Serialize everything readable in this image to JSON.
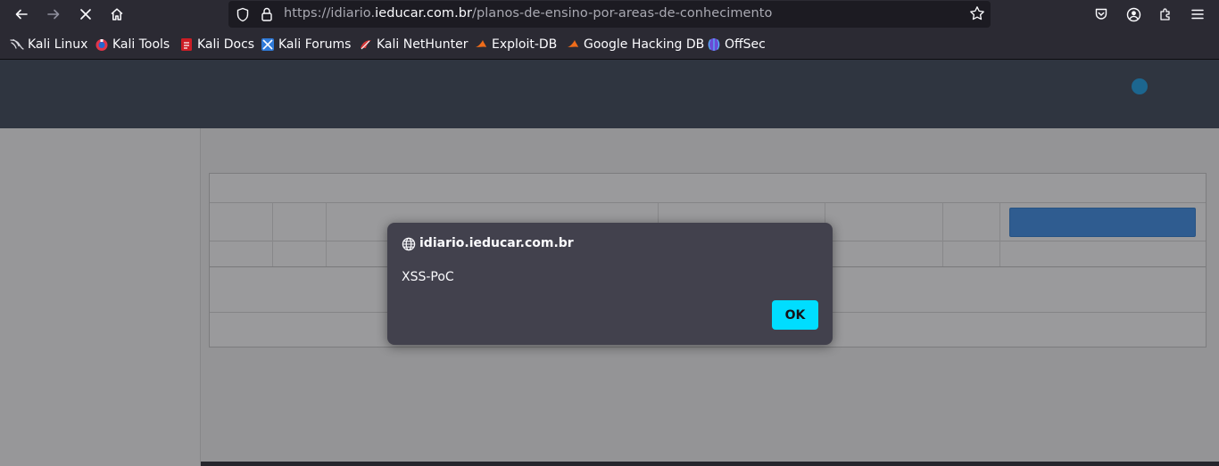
{
  "browser": {
    "url_scheme": "https://",
    "url_host_pre": "idiario.",
    "url_host_main": "ieducar.com.br",
    "url_path": "/planos-de-ensino-por-areas-de-conhecimento",
    "icons": {
      "back": "back-arrow-icon",
      "forward": "forward-arrow-icon",
      "stop": "stop-loading-icon",
      "home": "home-icon",
      "shield": "tracking-protection-shield-icon",
      "lock": "lock-icon",
      "star": "bookmark-star-icon",
      "pocket": "pocket-icon",
      "account": "account-icon",
      "extensions": "extensions-icon",
      "menu": "hamburger-menu-icon"
    }
  },
  "bookmarks": [
    {
      "label": "Kali Linux",
      "icon": "kali-dragon-icon"
    },
    {
      "label": "Kali Tools",
      "icon": "kali-tools-icon"
    },
    {
      "label": "Kali Docs",
      "icon": "kali-docs-icon"
    },
    {
      "label": "Kali Forums",
      "icon": "kali-forums-icon"
    },
    {
      "label": "Kali NetHunter",
      "icon": "kali-nethunter-icon"
    },
    {
      "label": "Exploit-DB",
      "icon": "exploit-db-icon"
    },
    {
      "label": "Google Hacking DB",
      "icon": "ghdb-icon"
    },
    {
      "label": "OffSec",
      "icon": "offsec-icon"
    }
  ],
  "dialog": {
    "origin": "idiario.ieducar.com.br",
    "message": "XSS-PoC",
    "ok_label": "OK"
  },
  "colors": {
    "accent_ok": "#00ddff",
    "page_header": "#3c4858",
    "header_dot": "#1aa0e8",
    "table_button": "#3c8fea"
  }
}
